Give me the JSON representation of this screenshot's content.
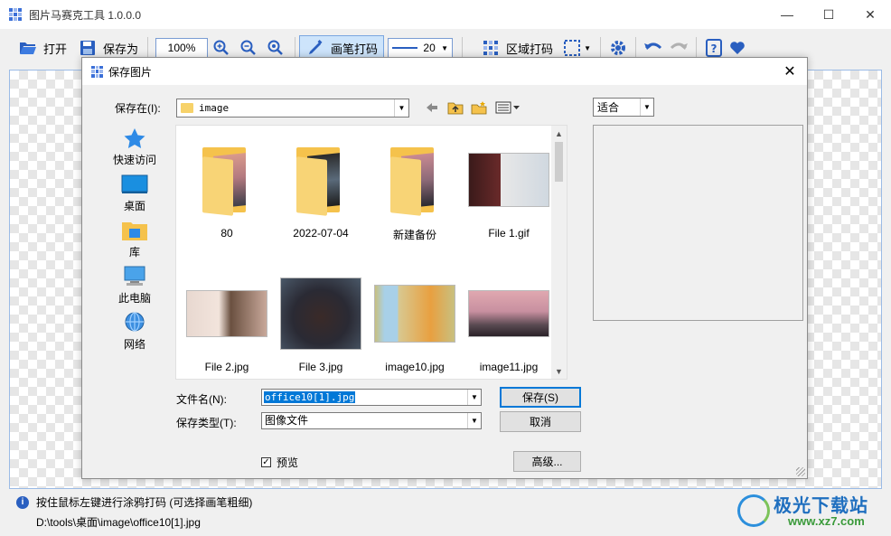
{
  "app": {
    "title": "图片马赛克工具 1.0.0.0",
    "controls": {
      "minimize": "—",
      "maximize": "☐",
      "close": "✕"
    }
  },
  "toolbar": {
    "open_label": "打开",
    "saveas_label": "保存为",
    "zoom_value": "100%",
    "brush_label": "画笔打码",
    "brush_width": "20",
    "region_label": "区域打码"
  },
  "status": {
    "hint": "按住鼠标左键进行涂鸦打码 (可选择画笔粗细)",
    "path": "D:\\tools\\桌面\\image\\office10[1].jpg"
  },
  "watermark": {
    "title": "极光下载站",
    "url": "www.xz7.com"
  },
  "dialog": {
    "title": "保存图片",
    "save_in_label": "保存在(I):",
    "save_in_value": "image",
    "places": [
      {
        "label": "快速访问",
        "icon": "star-icon"
      },
      {
        "label": "桌面",
        "icon": "desktop-icon"
      },
      {
        "label": "库",
        "icon": "library-icon"
      },
      {
        "label": "此电脑",
        "icon": "computer-icon"
      },
      {
        "label": "网络",
        "icon": "network-icon"
      }
    ],
    "files": [
      {
        "name": "80",
        "kind": "folder"
      },
      {
        "name": "2022-07-04",
        "kind": "folder"
      },
      {
        "name": "新建备份",
        "kind": "folder"
      },
      {
        "name": "File 1.gif",
        "kind": "image"
      },
      {
        "name": "File 2.jpg",
        "kind": "image"
      },
      {
        "name": "File 3.jpg",
        "kind": "image"
      },
      {
        "name": "image10.jpg",
        "kind": "image"
      },
      {
        "name": "image11.jpg",
        "kind": "image"
      }
    ],
    "fit_value": "适合",
    "filename_label": "文件名(N):",
    "filename_value": "office10[1].jpg",
    "filetype_label": "保存类型(T):",
    "filetype_value": "图像文件",
    "save_button": "保存(S)",
    "cancel_button": "取消",
    "advanced_button": "高级...",
    "preview_label": "预览",
    "preview_checked": true
  },
  "colors": {
    "accent": "#0078d7",
    "toolbar_active": "#cde4fb",
    "folder": "#f5c24c"
  }
}
